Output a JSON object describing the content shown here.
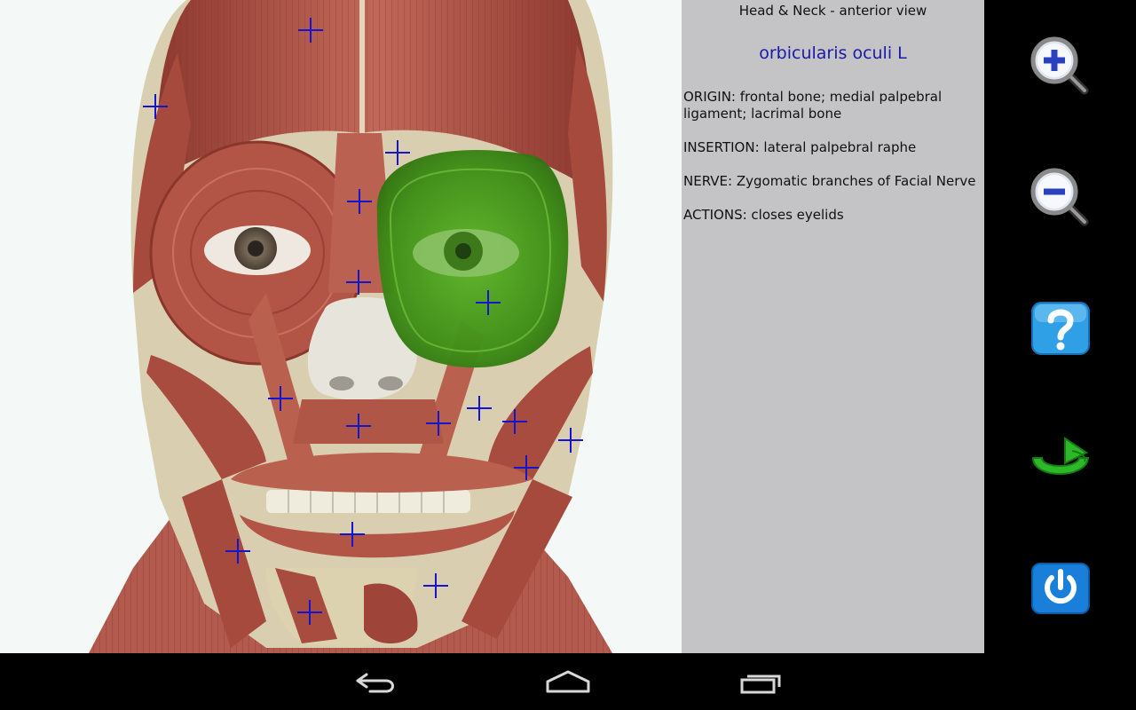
{
  "panel": {
    "view_title": "Head & Neck - anterior view",
    "muscle_name": "orbicularis oculi L",
    "origin": "ORIGIN: frontal bone; medial palpebral ligament; lacrimal bone",
    "insertion": "INSERTION: lateral palpebral raphe",
    "nerve": "NERVE: Zygomatic branches of Facial Nerve",
    "actions": "ACTIONS: closes eyelids"
  },
  "toolbar": {
    "icons": [
      "zoom-in-icon",
      "zoom-out-icon",
      "help-icon",
      "reset-icon",
      "power-icon"
    ]
  },
  "navbar": {
    "icons": [
      "back-icon",
      "home-icon",
      "recent-apps-icon"
    ]
  },
  "colors": {
    "info_panel_bg": "#c4c4c6",
    "muscle_name": "#1a1aa8",
    "marker": "#1515d0",
    "highlight": "#4ea31f",
    "muscle": "#b5574a"
  }
}
